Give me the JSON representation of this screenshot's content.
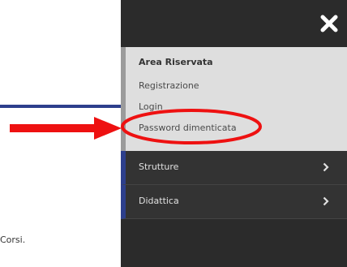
{
  "background_page": {
    "fragment_text": "Corsi."
  },
  "menu": {
    "close_icon": "close-x-icon",
    "reserved_area": {
      "title": "Area Riservata",
      "links": [
        "Registrazione",
        "Login",
        "Password dimenticata"
      ]
    },
    "sections": [
      {
        "label": "Strutture",
        "icon": "chevron-right-icon"
      },
      {
        "label": "Didattica",
        "icon": "chevron-right-icon"
      }
    ]
  },
  "annotation": {
    "arrow_color": "#ee1111",
    "highlight_color": "#ee1111",
    "highlighted_item": "Password dimenticata"
  },
  "colors": {
    "panel_dark": "#2b2b2b",
    "reserved_bg": "#dedede",
    "accent_blue": "#2d3f8c"
  }
}
